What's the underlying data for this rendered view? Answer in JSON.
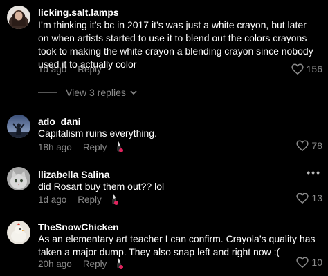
{
  "comments": [
    {
      "username": "licking.salt.lamps",
      "text": "I’m thinking it’s bc in 2017 it’s was just a white crayon, but later on when artists started to use it to blend out the colors crayons took to making the white crayon a blending crayon since nobody used it to actually color",
      "time": "1d ago",
      "reply": "Reply",
      "likes": "156",
      "view_replies": "View 3 replies"
    },
    {
      "username": "ado_dani",
      "text": "Capitalism ruins everything.",
      "time": "18h ago",
      "reply": "Reply",
      "likes": "78"
    },
    {
      "username": "llizabella Salina",
      "text": "did Rosart buy them out?? lol",
      "time": "1d ago",
      "reply": "Reply",
      "likes": "13"
    },
    {
      "username": "TheSnowChicken",
      "text": "As an elementary art teacher I can confirm. Crayola’s quality has taken a major dump. They also snap left and right now :(",
      "time": "20h ago",
      "reply": "Reply",
      "likes": "10"
    }
  ],
  "icons": {
    "like": "heart-outline-icon",
    "chevron": "chevron-down-icon",
    "more": "more-options-icon",
    "creator_reaction": "lighter-emoji-icon"
  },
  "colors": {
    "background": "#000000",
    "text": "#ffffff",
    "muted": "#8a8a8a"
  }
}
